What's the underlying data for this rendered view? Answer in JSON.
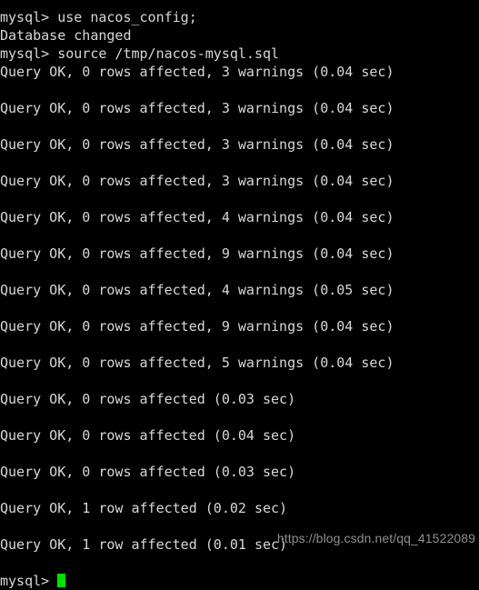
{
  "terminal": {
    "background_color": "#010101",
    "foreground_color": "#d7d7d7",
    "cursor_color": "#00e000",
    "lines": [
      {
        "id": "cmd-use-database",
        "text": "mysql> use nacos_config;",
        "spacer_after": false
      },
      {
        "id": "database-changed",
        "text": "Database changed",
        "spacer_after": false
      },
      {
        "id": "cmd-source-sql",
        "text": "mysql> source /tmp/nacos-mysql.sql",
        "spacer_after": false
      },
      {
        "id": "result-1",
        "text": "Query OK, 0 rows affected, 3 warnings (0.04 sec)",
        "spacer_after": true
      },
      {
        "id": "result-2",
        "text": "Query OK, 0 rows affected, 3 warnings (0.04 sec)",
        "spacer_after": true
      },
      {
        "id": "result-3",
        "text": "Query OK, 0 rows affected, 3 warnings (0.04 sec)",
        "spacer_after": true
      },
      {
        "id": "result-4",
        "text": "Query OK, 0 rows affected, 3 warnings (0.04 sec)",
        "spacer_after": true
      },
      {
        "id": "result-5",
        "text": "Query OK, 0 rows affected, 4 warnings (0.04 sec)",
        "spacer_after": true
      },
      {
        "id": "result-6",
        "text": "Query OK, 0 rows affected, 9 warnings (0.04 sec)",
        "spacer_after": true
      },
      {
        "id": "result-7",
        "text": "Query OK, 0 rows affected, 4 warnings (0.05 sec)",
        "spacer_after": true
      },
      {
        "id": "result-8",
        "text": "Query OK, 0 rows affected, 9 warnings (0.04 sec)",
        "spacer_after": true
      },
      {
        "id": "result-9",
        "text": "Query OK, 0 rows affected, 5 warnings (0.04 sec)",
        "spacer_after": true
      },
      {
        "id": "result-10",
        "text": "Query OK, 0 rows affected (0.03 sec)",
        "spacer_after": true
      },
      {
        "id": "result-11",
        "text": "Query OK, 0 rows affected (0.04 sec)",
        "spacer_after": true
      },
      {
        "id": "result-12",
        "text": "Query OK, 0 rows affected (0.03 sec)",
        "spacer_after": true
      },
      {
        "id": "result-13",
        "text": "Query OK, 1 row affected (0.02 sec)",
        "spacer_after": true
      },
      {
        "id": "result-14",
        "text": "Query OK, 1 row affected (0.01 sec)",
        "spacer_after": true
      }
    ],
    "final_prompt": "mysql> "
  },
  "watermark": {
    "text": "https://blog.csdn.net/qq_41522089"
  }
}
